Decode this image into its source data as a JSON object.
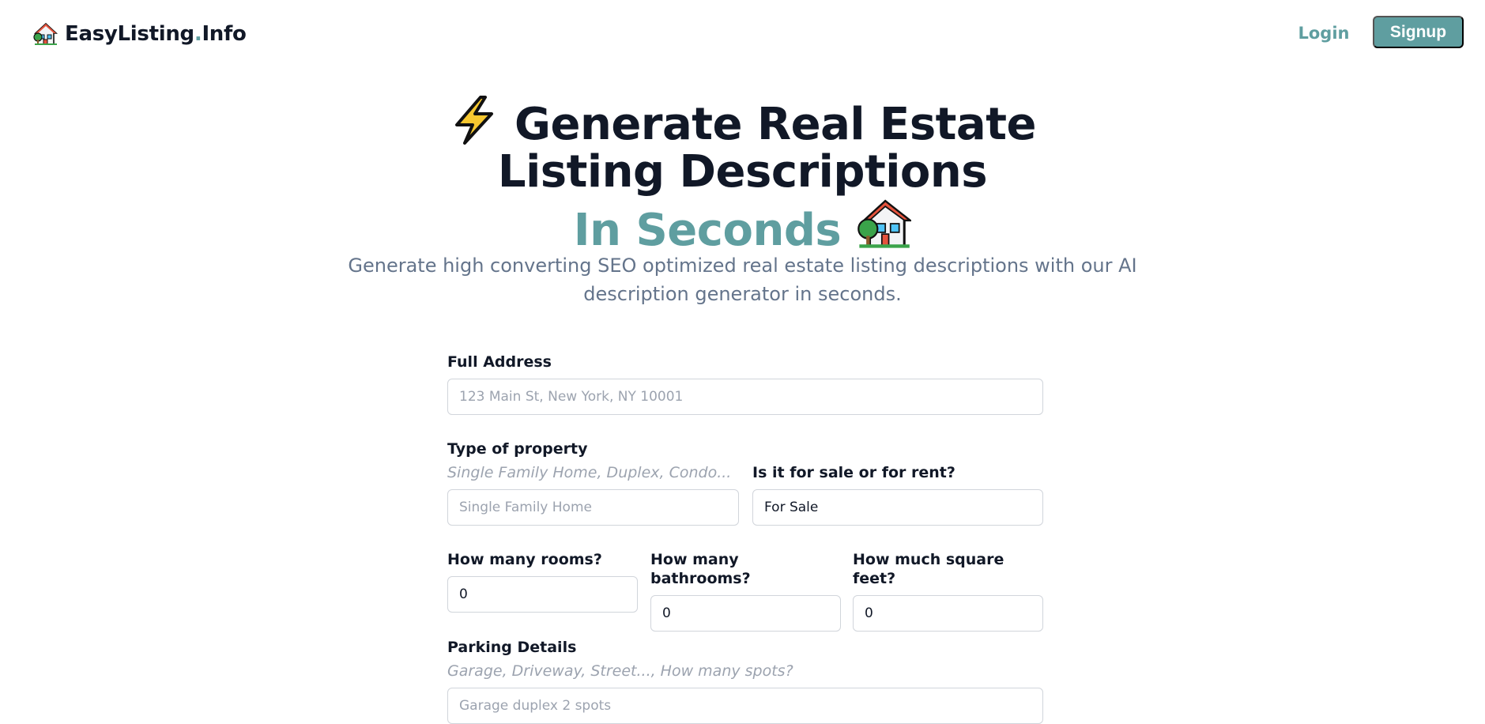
{
  "header": {
    "brand_name": "EasyListing",
    "brand_dot": ".",
    "brand_suffix": "Info",
    "brand_icon": "house-with-garden-icon",
    "login_label": "Login",
    "signup_label": "Signup"
  },
  "hero": {
    "title_line1": "Generate Real Estate",
    "title_line2": "Listing Descriptions",
    "title_line3": "In Seconds",
    "title_icon_start": "high-voltage-icon",
    "title_icon_end": "house-with-garden-icon",
    "subtitle_line1": "Generate high converting SEO optimized real estate listing descriptions with our AI",
    "subtitle_line2": "description generator in seconds."
  },
  "form": {
    "address": {
      "label": "Full Address",
      "placeholder": "123 Main St, New York, NY 10001",
      "value": ""
    },
    "property_type": {
      "label": "Type of property",
      "hint": "Single Family Home, Duplex, Condo...",
      "placeholder": "Single Family Home",
      "value": ""
    },
    "sale_or_rent": {
      "label": "Is it for sale or for rent?",
      "value": "For Sale"
    },
    "rooms": {
      "label": "How many rooms?",
      "value": "0"
    },
    "bathrooms": {
      "label": "How many bathrooms?",
      "value": "0"
    },
    "square_feet": {
      "label": "How much square feet?",
      "value": "0"
    },
    "parking": {
      "label": "Parking Details",
      "hint": "Garage, Driveway, Street..., How many spots?",
      "placeholder": "Garage duplex 2 spots",
      "value": ""
    }
  },
  "colors": {
    "accent": "#5f9ea0",
    "heading": "#111827",
    "muted": "#64748b",
    "placeholder": "#9ca3af"
  }
}
